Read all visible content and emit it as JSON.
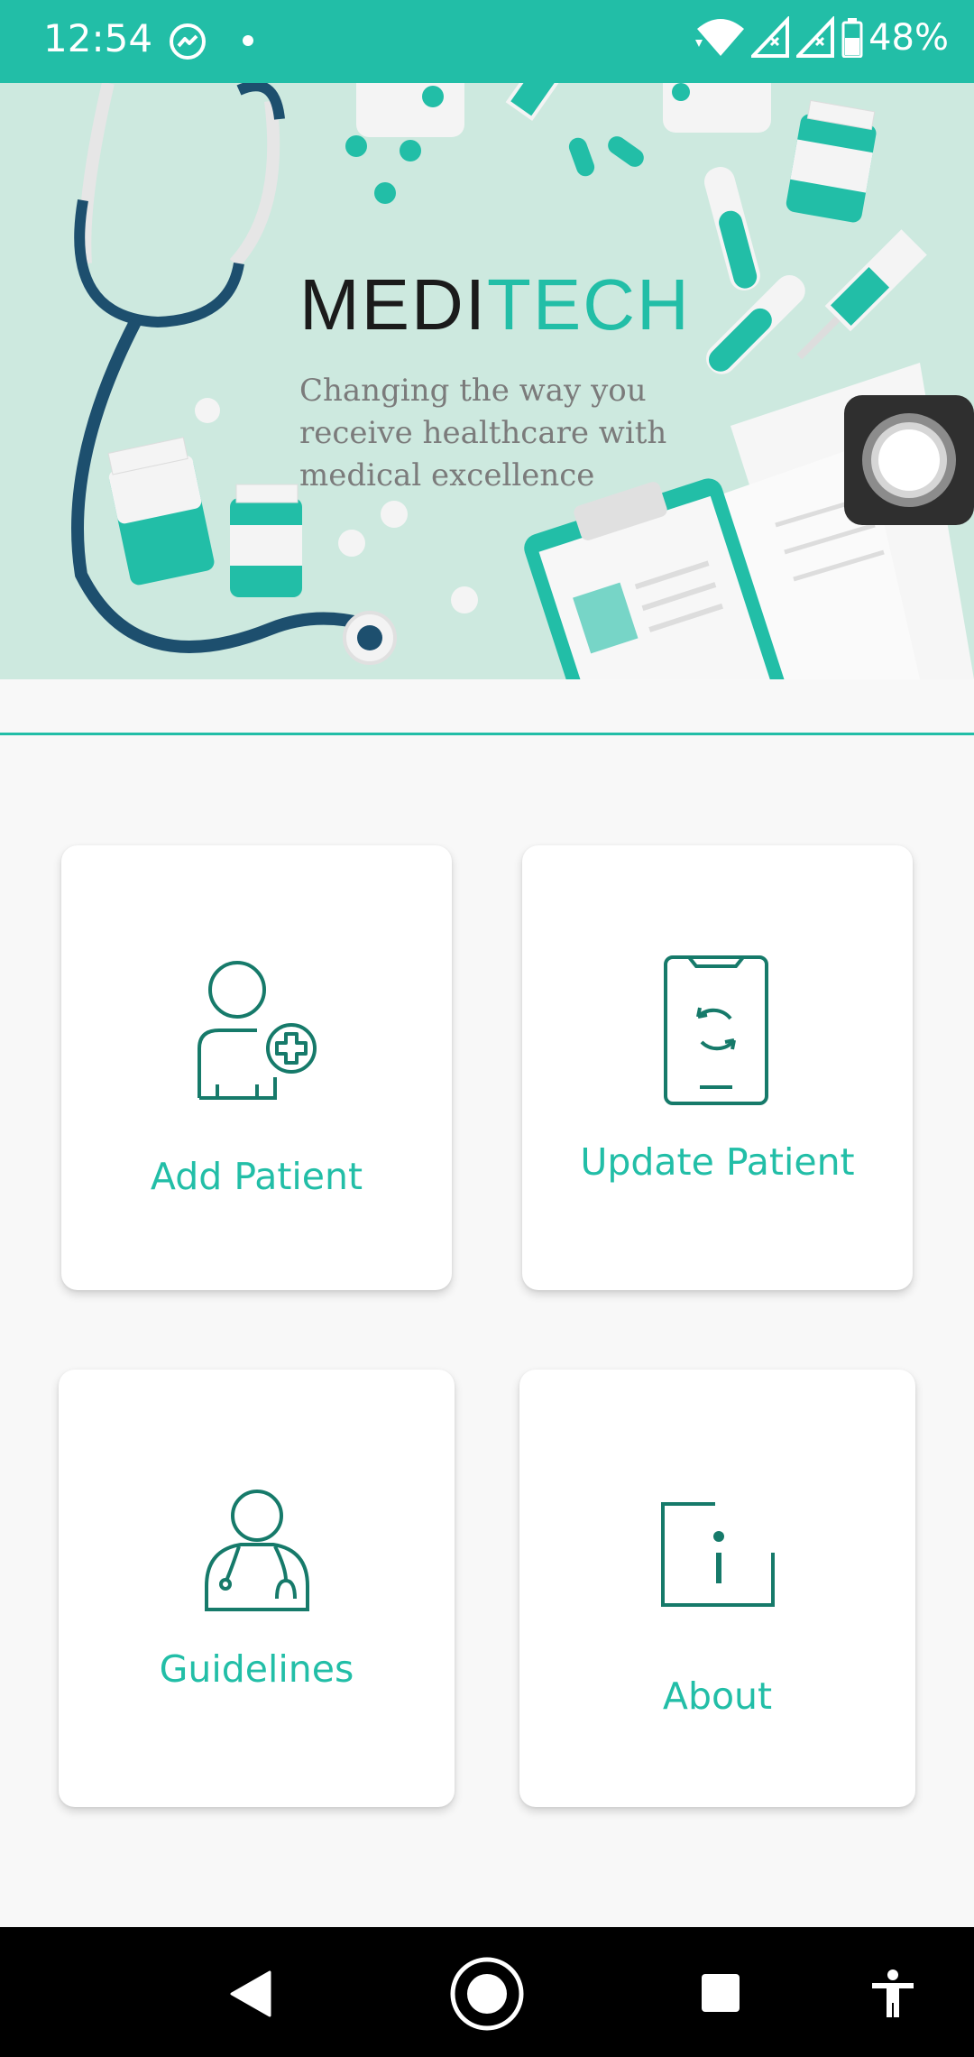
{
  "status_bar": {
    "time": "12:54",
    "battery": "48%",
    "icons": [
      "messenger-icon",
      "notification-dot-icon",
      "wifi-icon",
      "signal-icon",
      "signal-icon",
      "battery-icon"
    ]
  },
  "banner": {
    "brand_part1": "MEDI",
    "brand_part2": "TECH",
    "tagline": "Changing the way you receive healthcare with medical excellence"
  },
  "cards": {
    "add_patient": "Add Patient",
    "update_patient": "Update Patient",
    "guidelines": "Guidelines",
    "about": "About"
  },
  "colors": {
    "accent": "#22bea7",
    "icon_dark_teal": "#167a6a",
    "banner_bg": "#cde9df",
    "stethoscope": "#1d4f6e"
  },
  "nav_bar": {
    "icons": [
      "back-icon",
      "home-icon",
      "recents-icon",
      "accessibility-icon"
    ]
  }
}
